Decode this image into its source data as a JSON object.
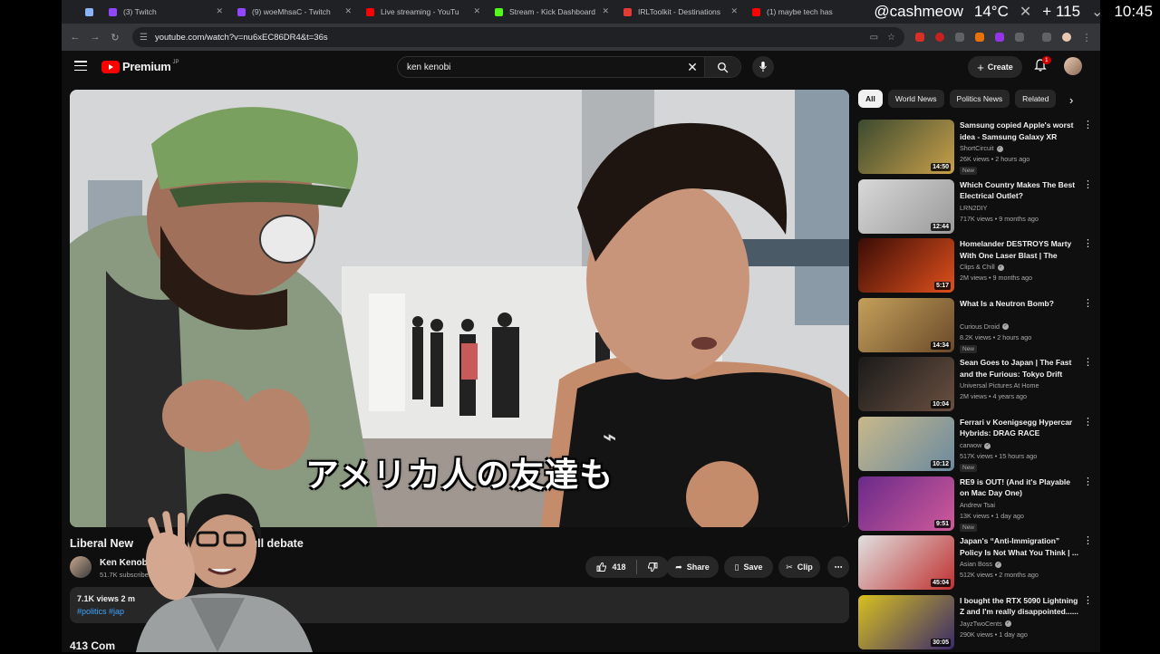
{
  "browser": {
    "tabs": [
      {
        "label": "",
        "color": "#8ab4f8"
      },
      {
        "label": "(3) Twitch",
        "color": "#9146ff"
      },
      {
        "label": "(9) woeMhsaC - Twitch",
        "color": "#9146ff"
      },
      {
        "label": "Live streaming - YouTu",
        "color": "#ff0000"
      },
      {
        "label": "Stream - Kick Dashboard",
        "color": "#53fc18"
      },
      {
        "label": "IRLToolkit - Destinations",
        "color": "#e53935"
      },
      {
        "label": "(1) maybe tech has",
        "color": "#ff0000"
      }
    ],
    "url": "youtube.com/watch?v=nu6xEC86DR4&t=36s",
    "overlay": {
      "handle": "@cashmeow",
      "temp": "14°C",
      "plus": "+",
      "count": "115",
      "time": "10:45"
    }
  },
  "yt": {
    "logo_text": "Premium",
    "logo_region": "JP",
    "search_query": "ken kenobi",
    "create_label": "Create",
    "notif_count": "1"
  },
  "video": {
    "subtitle": "アメリカ人の友達も",
    "title_start": "Liberal New ",
    "title_end": "...full debate",
    "channel_name": "Ken Kenobi",
    "subscribers": "51.7K subscribers",
    "likes": "418",
    "share_label": "Share",
    "save_label": "Save",
    "clip_label": "Clip",
    "views_line": "7.1K views  2 m",
    "tags": "#politics  #jap",
    "comments": "413 Com"
  },
  "chips": [
    "All",
    "World News",
    "Politics News",
    "Related"
  ],
  "recommendations": [
    {
      "title": "Samsung copied Apple's worst idea - Samsung Galaxy XR",
      "channel": "ShortCircuit",
      "verified": true,
      "meta": "26K views • 2 hours ago",
      "new": true,
      "duration": "14:50",
      "c1": "#3b4a2f",
      "c2": "#c9a04a"
    },
    {
      "title": "Which Country Makes The Best Electrical Outlet?",
      "channel": "LRN2DIY",
      "verified": false,
      "meta": "717K views • 9 months ago",
      "new": false,
      "duration": "12:44",
      "c1": "#d8d8d8",
      "c2": "#9a9a9a"
    },
    {
      "title": "Homelander DESTROYS Marty With One Laser Blast | The Boy...",
      "channel": "Clips & Chill",
      "verified": true,
      "meta": "2M views • 9 months ago",
      "new": false,
      "duration": "5:17",
      "c1": "#3a0c06",
      "c2": "#e0501c"
    },
    {
      "title": "What Is a Neutron Bomb?",
      "channel": "Curious Droid",
      "verified": true,
      "meta": "8.2K views • 2 hours ago",
      "new": true,
      "duration": "14:34",
      "c1": "#c4a05a",
      "c2": "#6a4a2a"
    },
    {
      "title": "Sean Goes to Japan | The Fast and the Furious: Tokyo Drift",
      "channel": "Universal Pictures At Home",
      "verified": false,
      "meta": "2M views • 4 years ago",
      "new": false,
      "duration": "10:04",
      "c1": "#1a1a1a",
      "c2": "#6a5040"
    },
    {
      "title": "Ferrari v Koenigsegg Hypercar Hybrids: DRAG RACE",
      "channel": "carwow",
      "verified": true,
      "meta": "517K views • 15 hours ago",
      "new": true,
      "duration": "10:12",
      "c1": "#c8b88a",
      "c2": "#6a8aa0"
    },
    {
      "title": "RE9 is OUT! (And it's Playable on Mac Day One)",
      "channel": "Andrew Tsai",
      "verified": false,
      "meta": "13K views • 1 day ago",
      "new": true,
      "duration": "9:51",
      "c1": "#6a2a8a",
      "c2": "#d05a9a"
    },
    {
      "title": "Japan's “Anti-Immigration” Policy Is Not What You Think | ...",
      "channel": "Asian Boss",
      "verified": true,
      "meta": "512K views • 2 months ago",
      "new": false,
      "duration": "45:04",
      "c1": "#e0e0e0",
      "c2": "#c03030"
    },
    {
      "title": "I bought the RTX 5090 Lightning Z and I'm really disappointed......",
      "channel": "JayzTwoCents",
      "verified": true,
      "meta": "290K views • 1 day ago",
      "new": false,
      "duration": "30:05",
      "c1": "#d8c020",
      "c2": "#3a2a6a"
    }
  ],
  "icons": {
    "search": "search-icon",
    "mic": "mic-icon",
    "bell": "bell-icon",
    "like": "thumbs-up-icon",
    "dislike": "thumbs-down-icon",
    "share": "share-icon",
    "save": "save-icon",
    "clip": "scissors-icon",
    "more": "more-horiz-icon"
  }
}
